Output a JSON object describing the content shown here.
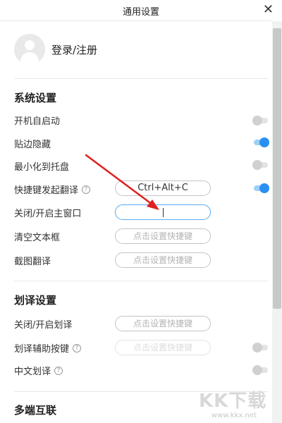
{
  "window": {
    "title": "通用设置",
    "close_label": "✕"
  },
  "account": {
    "label": "登录/注册"
  },
  "system": {
    "title": "系统设置",
    "rows": [
      {
        "label": "开机自启动",
        "enabled": false
      },
      {
        "label": "贴边隐藏",
        "enabled": true
      },
      {
        "label": "最小化到托盘",
        "enabled": false
      },
      {
        "label": "快捷键发起翻译",
        "enabled": true,
        "hotkey": "Ctrl+Alt+C"
      },
      {
        "label": "关闭/开启主窗口",
        "hotkey": ""
      },
      {
        "label": "清空文本框",
        "hotkey_placeholder": "点击设置快捷键"
      },
      {
        "label": "截图翻译",
        "hotkey_placeholder": "点击设置快捷键"
      }
    ]
  },
  "selection": {
    "title": "划译设置",
    "rows": [
      {
        "label": "关闭/开启划译",
        "hotkey_placeholder": "点击设置快捷键"
      },
      {
        "label": "划译辅助按键",
        "enabled": false,
        "hotkey_placeholder": "点击设置快捷键"
      },
      {
        "label": "中文划译",
        "enabled": false
      }
    ]
  },
  "multi_device": {
    "title": "多端互联"
  },
  "help_glyph": "?",
  "watermark": {
    "text": "KK下载",
    "url": "www.kkx.net"
  },
  "colors": {
    "accent": "#2a8ff0",
    "arrow": "#e02020"
  }
}
